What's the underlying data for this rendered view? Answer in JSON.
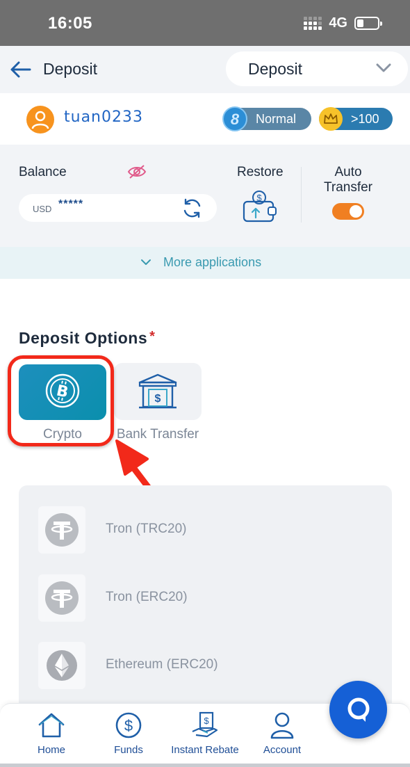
{
  "status_bar": {
    "time": "16:05",
    "network": "4G"
  },
  "header": {
    "title": "Deposit",
    "select_value": "Deposit"
  },
  "user": {
    "username": "tuan0233",
    "level_badge": "Normal",
    "count_badge": ">100"
  },
  "balance": {
    "label": "Balance",
    "currency": "USD",
    "masked_value": "*****",
    "restore_label": "Restore",
    "auto_transfer_label": "Auto Transfer",
    "auto_transfer_on": true
  },
  "more_applications": "More applications",
  "deposit_options": {
    "title": "Deposit Options",
    "required_mark": "*",
    "options": [
      {
        "label": "Crypto",
        "selected": true
      },
      {
        "label": "Bank Transfer",
        "selected": false
      }
    ]
  },
  "coins": [
    {
      "label": "Tron (TRC20)",
      "icon": "tether-icon"
    },
    {
      "label": "Tron (ERC20)",
      "icon": "tether-icon"
    },
    {
      "label": "Ethereum (ERC20)",
      "icon": "ethereum-icon"
    }
  ],
  "bottom_nav": {
    "items": [
      {
        "label": "Home",
        "icon": "home-icon"
      },
      {
        "label": "Funds",
        "icon": "dollar-icon"
      },
      {
        "label": "Instant Rebate",
        "icon": "rebate-icon"
      },
      {
        "label": "Account",
        "icon": "account-icon"
      }
    ]
  },
  "colors": {
    "accent_orange": "#f07f22",
    "brand_blue": "#1560d6",
    "crypto_teal": "#0b8fad",
    "annotation_red": "#f2291a"
  }
}
